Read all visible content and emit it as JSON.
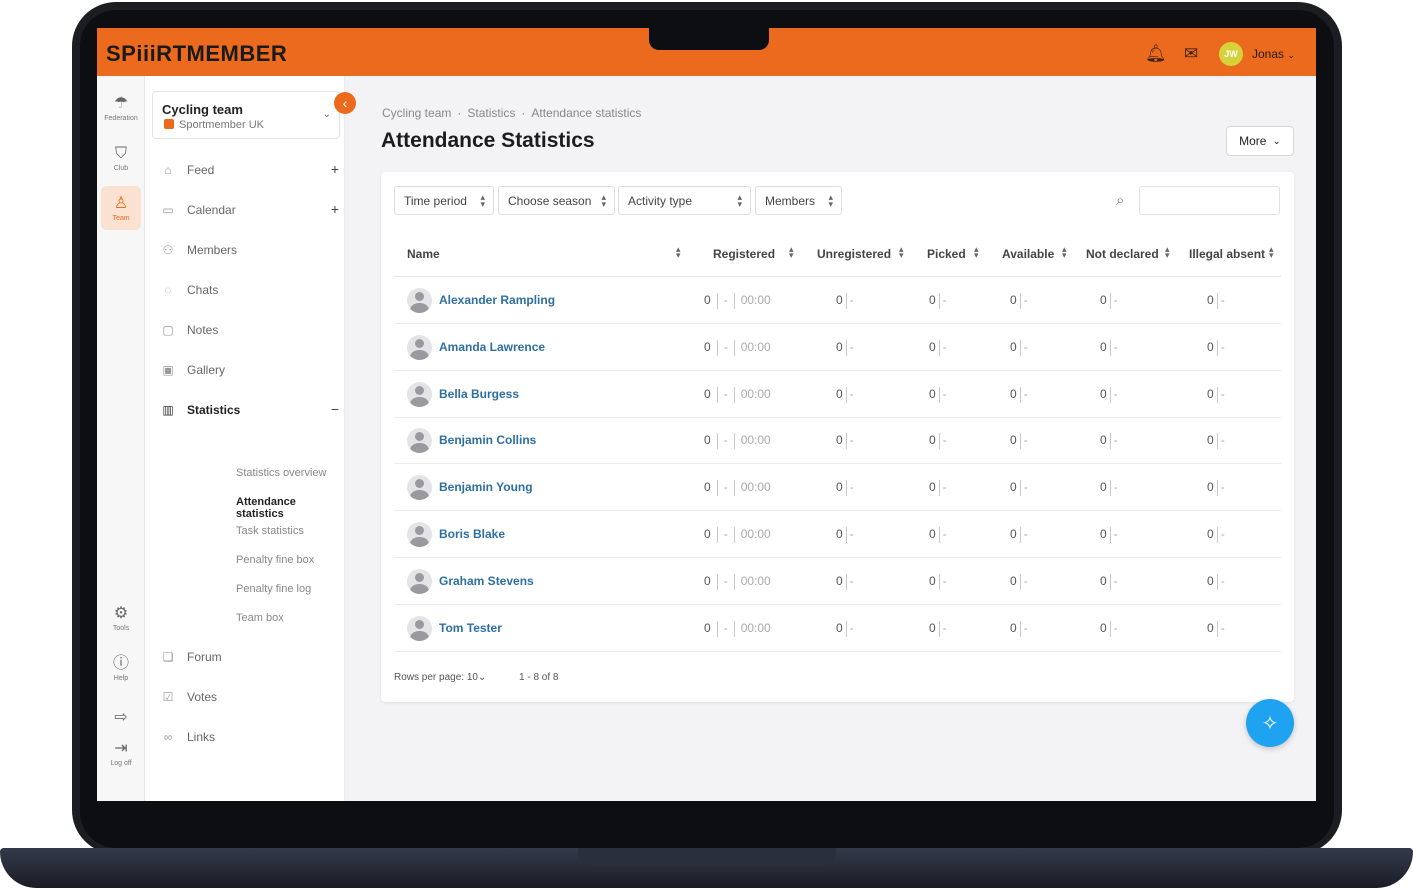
{
  "brand": {
    "logo": "SPiiiRTMEMBER",
    "accent": "#ec6a1e",
    "link": "#2e6fa3",
    "fab": "#1fa3f0"
  },
  "topbar": {
    "bell_icon": "bell-icon",
    "mail_icon": "mail-icon",
    "avatar_initials": "JW",
    "user_name": "Jonas"
  },
  "rail": [
    {
      "label": "Federation",
      "icon": "umbrella-icon"
    },
    {
      "label": "Club",
      "icon": "shield-icon"
    },
    {
      "label": "Team",
      "icon": "team-icon"
    },
    {
      "label": "Tools",
      "icon": "gear-icon"
    },
    {
      "label": "Help",
      "icon": "help-icon"
    },
    {
      "label": "",
      "icon": "switch-icon"
    },
    {
      "label": "Log off",
      "icon": "logout-icon"
    }
  ],
  "team_selector": {
    "name": "Cycling team",
    "org": "Sportmember UK"
  },
  "sidebar": {
    "items": [
      {
        "label": "Feed",
        "icon": "home-icon"
      },
      {
        "label": "Calendar",
        "icon": "calendar-icon"
      },
      {
        "label": "Members",
        "icon": "members-icon"
      },
      {
        "label": "Chats",
        "icon": "chat-icon"
      },
      {
        "label": "Notes",
        "icon": "note-icon"
      },
      {
        "label": "Gallery",
        "icon": "gallery-icon"
      },
      {
        "label": "Statistics",
        "icon": "chart-icon"
      },
      {
        "label": "Forum",
        "icon": "forum-icon"
      },
      {
        "label": "Votes",
        "icon": "vote-icon"
      },
      {
        "label": "Links",
        "icon": "link-icon"
      }
    ],
    "statistics_sub": [
      "Statistics overview",
      "Attendance statistics",
      "Task statistics",
      "Penalty fine box",
      "Penalty fine log",
      "Team box"
    ]
  },
  "breadcrumb": [
    "Cycling team",
    "Statistics",
    "Attendance statistics"
  ],
  "page_title": "Attendance Statistics",
  "more_label": "More",
  "filters": [
    "Time period",
    "Choose season",
    "Activity type",
    "Members"
  ],
  "columns": [
    "Name",
    "Registered",
    "Unregistered",
    "Picked",
    "Available",
    "Not declared",
    "Illegal absent"
  ],
  "rows": [
    {
      "name": "Alexander Rampling",
      "registered": "0",
      "time": "00:00",
      "unregistered": "0",
      "picked": "0",
      "available": "0",
      "not_declared": "0",
      "illegal_absent": "0"
    },
    {
      "name": "Amanda Lawrence",
      "registered": "0",
      "time": "00:00",
      "unregistered": "0",
      "picked": "0",
      "available": "0",
      "not_declared": "0",
      "illegal_absent": "0"
    },
    {
      "name": "Bella Burgess",
      "registered": "0",
      "time": "00:00",
      "unregistered": "0",
      "picked": "0",
      "available": "0",
      "not_declared": "0",
      "illegal_absent": "0"
    },
    {
      "name": "Benjamin Collins",
      "registered": "0",
      "time": "00:00",
      "unregistered": "0",
      "picked": "0",
      "available": "0",
      "not_declared": "0",
      "illegal_absent": "0"
    },
    {
      "name": "Benjamin Young",
      "registered": "0",
      "time": "00:00",
      "unregistered": "0",
      "picked": "0",
      "available": "0",
      "not_declared": "0",
      "illegal_absent": "0"
    },
    {
      "name": "Boris Blake",
      "registered": "0",
      "time": "00:00",
      "unregistered": "0",
      "picked": "0",
      "available": "0",
      "not_declared": "0",
      "illegal_absent": "0"
    },
    {
      "name": "Graham Stevens",
      "registered": "0",
      "time": "00:00",
      "unregistered": "0",
      "picked": "0",
      "available": "0",
      "not_declared": "0",
      "illegal_absent": "0"
    },
    {
      "name": "Tom Tester",
      "registered": "0",
      "time": "00:00",
      "unregistered": "0",
      "picked": "0",
      "available": "0",
      "not_declared": "0",
      "illegal_absent": "0"
    }
  ],
  "footer": {
    "rows_per_page_label": "Rows per page:",
    "rows_per_page_value": "10",
    "range": "1 - 8 of 8"
  },
  "empty_dash": "-"
}
